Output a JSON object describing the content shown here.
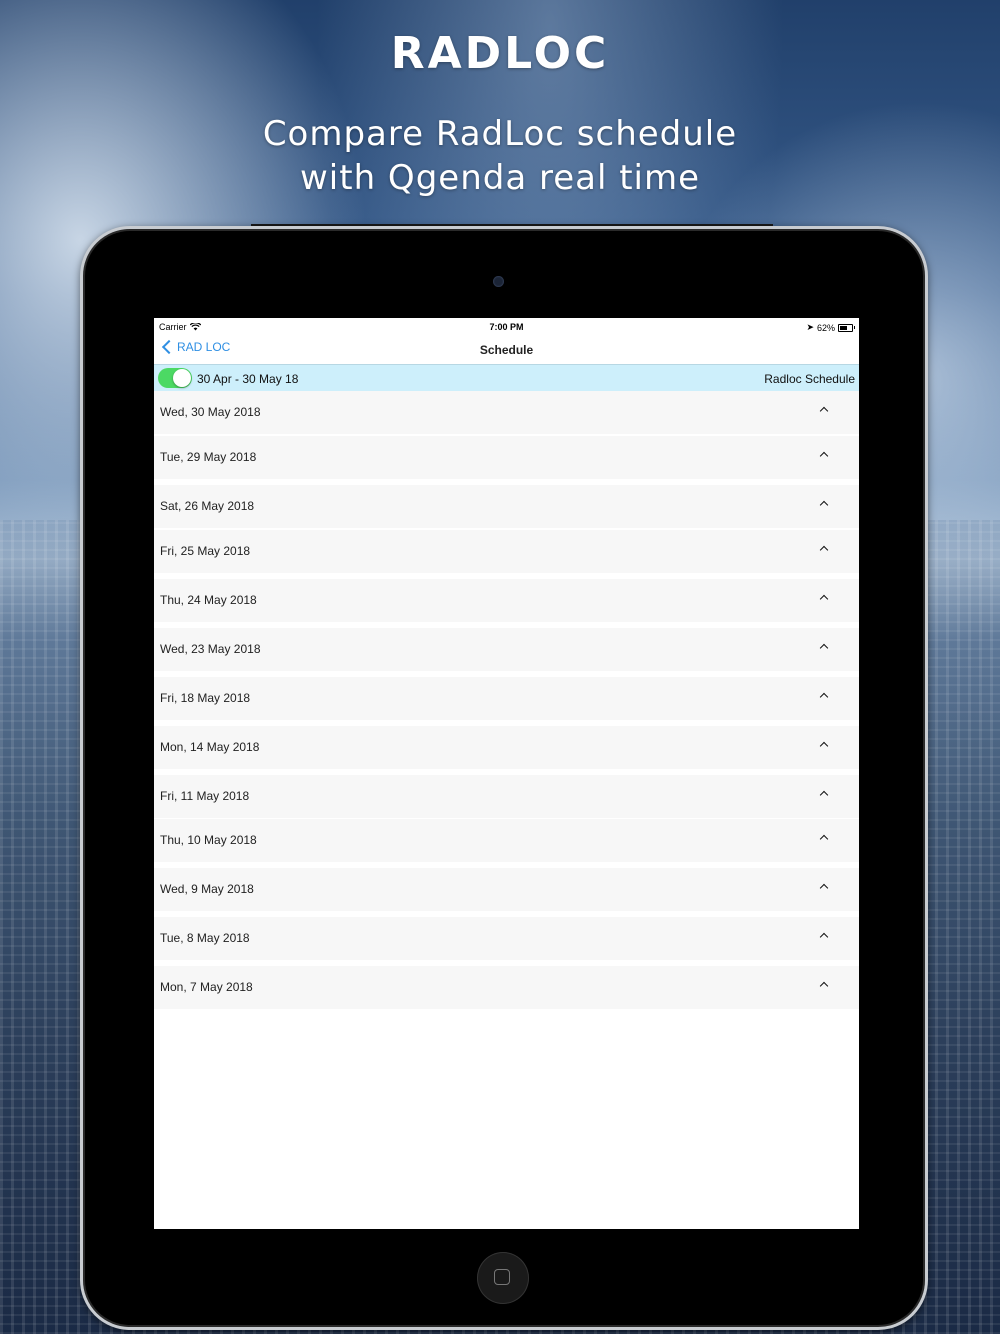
{
  "promo": {
    "title": "RADLOC",
    "tagline_line1": "Compare RadLoc schedule",
    "tagline_line2": "with Qgenda real time"
  },
  "status_bar": {
    "carrier": "Carrier",
    "time": "7:00 PM",
    "battery": "62%",
    "battery_level": 0.62
  },
  "nav": {
    "back_label": "RAD LOC",
    "title": "Schedule"
  },
  "filter": {
    "toggle_on": true,
    "date_range": "30 Apr - 30 May 18",
    "right_label": "Radloc Schedule"
  },
  "schedule": {
    "rows": [
      "Wed, 30 May 2018",
      "Tue, 29 May 2018",
      "Sat, 26 May 2018",
      "Fri, 25 May 2018",
      "Thu, 24 May 2018",
      "Wed, 23 May 2018",
      "Fri, 18 May 2018",
      "Mon, 14 May 2018",
      "Fri, 11 May 2018",
      "Thu, 10 May 2018",
      "Wed, 9 May 2018",
      "Tue, 8 May 2018",
      "Mon, 7 May 2018"
    ]
  },
  "colors": {
    "accent": "#2f8fe3",
    "toggle_on": "#4cd964",
    "filter_bg": "#cdeffb"
  }
}
